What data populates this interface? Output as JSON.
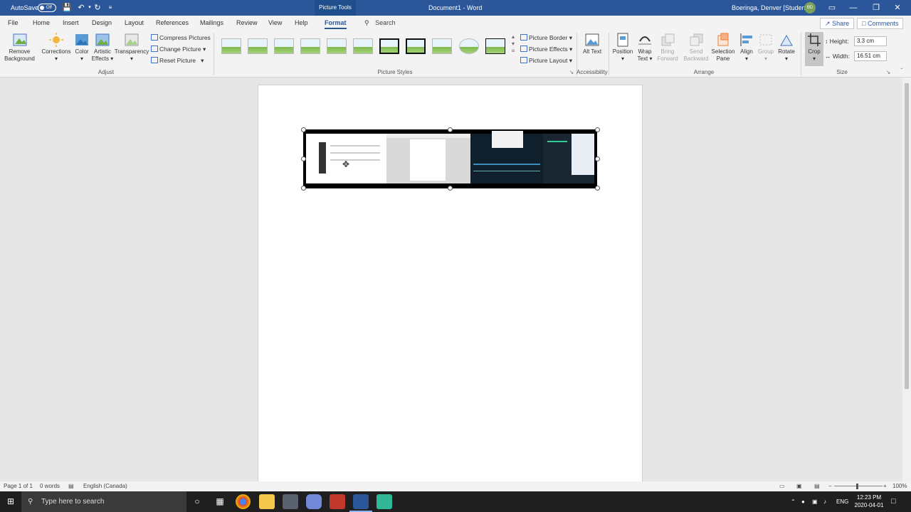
{
  "titlebar": {
    "autosave_label": "AutoSave",
    "autosave_state": "Off",
    "contextual_tab": "Picture Tools",
    "title": "Document1 - Word",
    "user": "Boeringa, Denver [Student]",
    "user_initials": "BD"
  },
  "tabs": [
    "File",
    "Home",
    "Insert",
    "Design",
    "Layout",
    "References",
    "Mailings",
    "Review",
    "View",
    "Help",
    "Format"
  ],
  "active_tab": "Format",
  "search_label": "Search",
  "share_label": "Share",
  "comments_label": "Comments",
  "ribbon": {
    "remove_background": "Remove Background",
    "corrections": "Corrections",
    "color": "Color",
    "artistic_effects": "Artistic Effects",
    "transparency": "Transparency",
    "compress_pictures": "Compress Pictures",
    "change_picture": "Change Picture",
    "reset_picture": "Reset Picture",
    "adjust_group": "Adjust",
    "picture_styles_group": "Picture Styles",
    "picture_border": "Picture Border",
    "picture_effects": "Picture Effects",
    "picture_layout": "Picture Layout",
    "alt_text": "Alt Text",
    "accessibility_group": "Accessibility",
    "position": "Position",
    "wrap_text": "Wrap Text",
    "bring_forward": "Bring Forward",
    "send_backward": "Send Backward",
    "selection_pane": "Selection Pane",
    "align": "Align",
    "group": "Group",
    "rotate": "Rotate",
    "arrange_group": "Arrange",
    "crop": "Crop",
    "height_label": "Height:",
    "height_value": "3.3 cm",
    "width_label": "Width:",
    "width_value": "16.51 cm",
    "size_group": "Size"
  },
  "statusbar": {
    "page": "Page 1 of 1",
    "words": "0 words",
    "language": "English (Canada)",
    "zoom": "100%"
  },
  "taskbar": {
    "search_placeholder": "Type here to search",
    "lang": "ENG",
    "time": "12:23 PM",
    "date": "2020-04-01"
  },
  "colors": {
    "word_blue": "#2b579a",
    "taskbar": "#1f1f1f"
  }
}
